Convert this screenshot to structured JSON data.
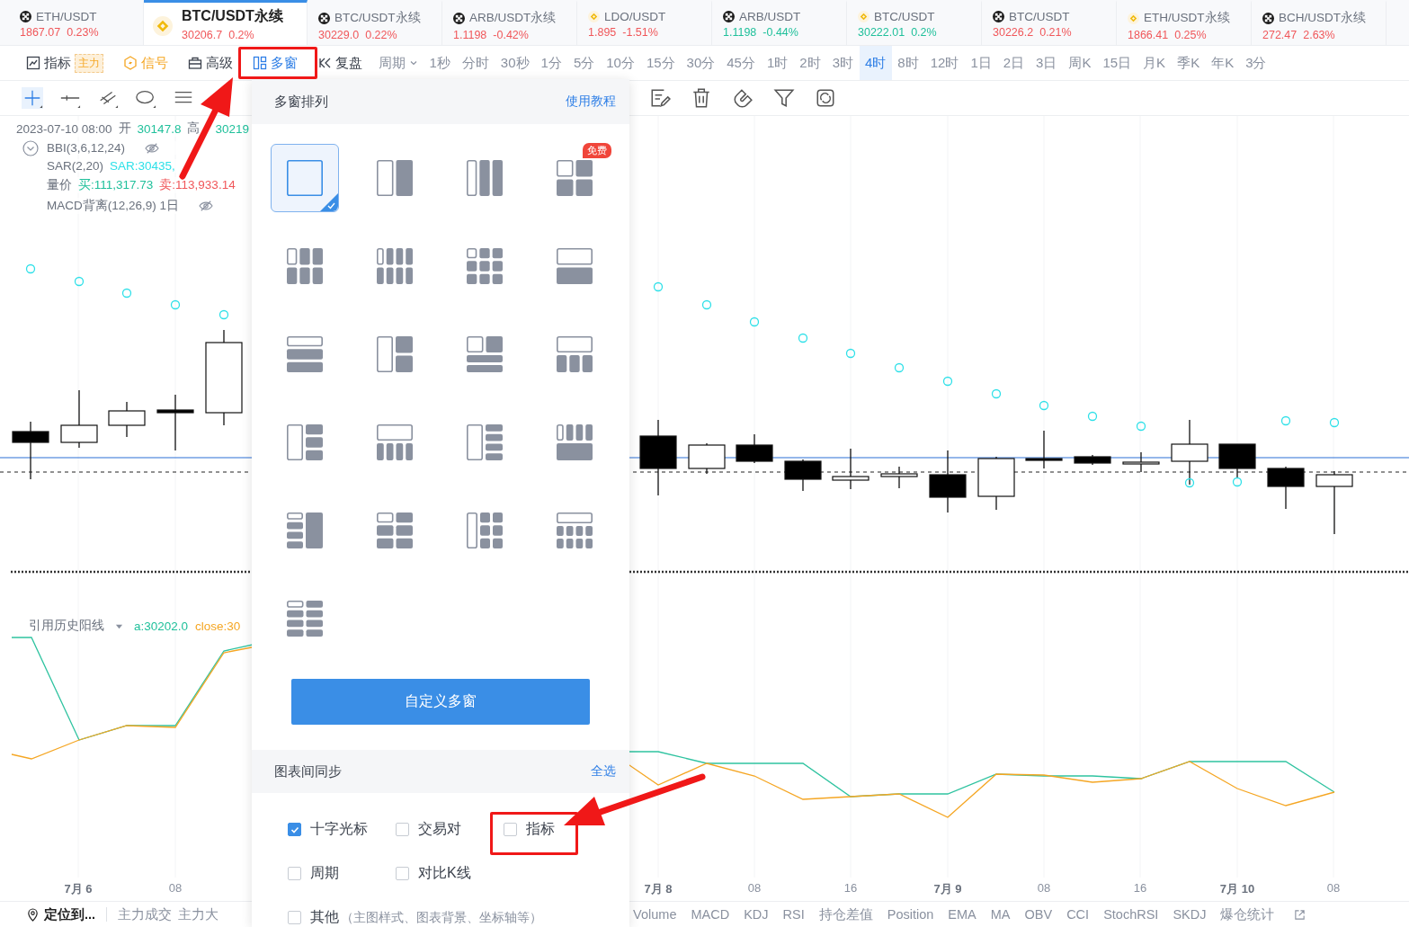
{
  "tickers": [
    {
      "name": "ETH/USDT",
      "kind": "okx",
      "price": "1867.07",
      "change": "0.23%",
      "color": "#f0575a",
      "selected": false
    },
    {
      "name": "BTC/USDT永续",
      "kind": "binance",
      "price": "30206.7",
      "change": "0.2%",
      "color": "#f0575a",
      "selected": true
    },
    {
      "name": "BTC/USDT永续",
      "kind": "okx",
      "price": "30229.0",
      "change": "0.22%",
      "color": "#f0575a",
      "selected": false
    },
    {
      "name": "ARB/USDT永续",
      "kind": "okx",
      "price": "1.1198",
      "change": "-0.42%",
      "color": "#f0575a",
      "selected": false
    },
    {
      "name": "LDO/USDT",
      "kind": "binance",
      "price": "1.895",
      "change": "-1.51%",
      "color": "#f0575a",
      "selected": false
    },
    {
      "name": "ARB/USDT",
      "kind": "okx",
      "price": "1.1198",
      "change": "-0.44%",
      "color": "#20c09b",
      "selected": false
    },
    {
      "name": "BTC/USDT",
      "kind": "binance",
      "price": "30222.01",
      "change": "0.2%",
      "color": "#20c09b",
      "selected": false
    },
    {
      "name": "BTC/USDT",
      "kind": "okx",
      "price": "30226.2",
      "change": "0.21%",
      "color": "#f0575a",
      "selected": false
    },
    {
      "name": "ETH/USDT永续",
      "kind": "binance",
      "price": "1866.41",
      "change": "0.25%",
      "color": "#f0575a",
      "selected": false
    },
    {
      "name": "BCH/USDT永续",
      "kind": "okx",
      "price": "272.47",
      "change": "2.63%",
      "color": "#f0575a",
      "selected": false
    }
  ],
  "toolbar": {
    "tools": [
      {
        "kind": "indicator",
        "label": "指标",
        "badge": "主力",
        "selected": false
      },
      {
        "kind": "signal",
        "label": "信号",
        "selected": false
      },
      {
        "kind": "advanced",
        "label": "高级",
        "selected": false
      },
      {
        "kind": "multi",
        "label": "多窗",
        "selected": true
      },
      {
        "kind": "replay",
        "label": "复盘",
        "selected": false
      },
      {
        "kind": "period",
        "label": "周期",
        "selected": false
      }
    ],
    "periods": [
      {
        "label": "1秒",
        "selected": false
      },
      {
        "label": "分时",
        "selected": false
      },
      {
        "label": "30秒",
        "selected": false
      },
      {
        "label": "1分",
        "selected": false
      },
      {
        "label": "5分",
        "selected": false
      },
      {
        "label": "10分",
        "selected": false
      },
      {
        "label": "15分",
        "selected": false
      },
      {
        "label": "30分",
        "selected": false
      },
      {
        "label": "45分",
        "selected": false
      },
      {
        "label": "1时",
        "selected": false
      },
      {
        "label": "2时",
        "selected": false
      },
      {
        "label": "3时",
        "selected": false
      },
      {
        "label": "4时",
        "selected": true
      },
      {
        "label": "8时",
        "selected": false
      },
      {
        "label": "12时",
        "selected": false
      },
      {
        "label": "1日",
        "selected": false
      },
      {
        "label": "2日",
        "selected": false
      },
      {
        "label": "3日",
        "selected": false
      },
      {
        "label": "周K",
        "selected": false
      },
      {
        "label": "15日",
        "selected": false
      },
      {
        "label": "月K",
        "selected": false
      },
      {
        "label": "季K",
        "selected": false
      },
      {
        "label": "年K",
        "selected": false
      },
      {
        "label": "3分",
        "selected": false
      }
    ]
  },
  "legend": {
    "datetime": "2023-07-10 08:00",
    "open_label": "开",
    "open": "30147.8",
    "high_label": "高",
    "high": "30219",
    "lines": [
      {
        "name": "BBI(3,6,12,24)",
        "hidden": true
      },
      {
        "name": "SAR(2,20)",
        "values": [
          {
            "text": "SAR:30435,",
            "color": "#2ee0e8"
          }
        ]
      },
      {
        "name": "量价",
        "values": [
          {
            "text": "买:111,317.73",
            "color": "#20c09b"
          },
          {
            "text": "卖:113,933.14",
            "color": "#f0575a"
          }
        ]
      },
      {
        "name": "MACD背离(12,26,9) 1日",
        "hidden": true
      }
    ]
  },
  "sub_legend": {
    "name": "引用历史阳线",
    "values": [
      {
        "text": "a:30202.0",
        "color": "#20c09b"
      },
      {
        "text": "close:30",
        "color": "#f5a623"
      }
    ]
  },
  "time_axis": [
    {
      "label": "7月 6",
      "kind": "day"
    },
    {
      "label": "08",
      "kind": "hour"
    },
    {
      "label": "7月 8",
      "kind": "day"
    },
    {
      "label": "08",
      "kind": "hour"
    },
    {
      "label": "16",
      "kind": "hour"
    },
    {
      "label": "7月 9",
      "kind": "day"
    },
    {
      "label": "08",
      "kind": "hour"
    },
    {
      "label": "16",
      "kind": "hour"
    },
    {
      "label": "7月 10",
      "kind": "day"
    },
    {
      "label": "08",
      "kind": "hour"
    }
  ],
  "bottom_bar": {
    "locate": "定位到...",
    "left_items": [
      "主力成交",
      "主力大"
    ],
    "indicators": [
      "Volume",
      "MACD",
      "KDJ",
      "RSI",
      "持仓差值",
      "Position",
      "EMA",
      "MA",
      "OBV",
      "CCI",
      "StochRSI",
      "SKDJ",
      "爆仓统计"
    ]
  },
  "popup": {
    "title": "多窗排列",
    "help_link": "使用教程",
    "layouts": [
      {
        "selected": true
      },
      {
        "selected": false
      },
      {
        "selected": false
      },
      {
        "selected": false,
        "badge": "免费"
      },
      {
        "selected": false
      },
      {
        "selected": false
      },
      {
        "selected": false
      },
      {
        "selected": false
      },
      {
        "selected": false
      },
      {
        "selected": false
      },
      {
        "selected": false
      },
      {
        "selected": false
      },
      {
        "selected": false
      },
      {
        "selected": false
      },
      {
        "selected": false
      },
      {
        "selected": false
      },
      {
        "selected": false
      },
      {
        "selected": false
      },
      {
        "selected": false
      },
      {
        "selected": false
      },
      {
        "selected": false
      }
    ],
    "custom_button": "自定义多窗",
    "sync_title": "图表间同步",
    "select_all": "全选",
    "sync_rows": [
      {
        "options": [
          {
            "label": "十字光标",
            "checked": true
          },
          {
            "label": "交易对",
            "checked": false
          },
          {
            "label": "指标",
            "checked": false
          }
        ]
      },
      {
        "options": [
          {
            "label": "周期",
            "checked": false
          },
          {
            "label": "对比K线",
            "checked": false
          }
        ]
      },
      {
        "options": [
          {
            "label": "其他",
            "note": "（主图样式、图表背景、坐标轴等）",
            "checked": false
          }
        ]
      }
    ]
  }
}
